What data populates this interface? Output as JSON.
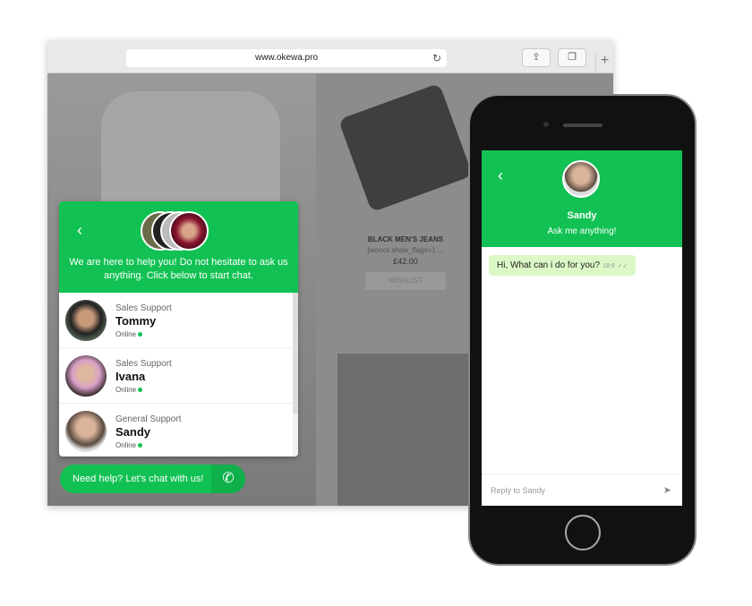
{
  "browser": {
    "url": "www.okewa.pro"
  },
  "product": {
    "title": "BLACK MEN'S JEANS",
    "subtitle": "[woocs show_flags=1 ...",
    "price": "£42.00",
    "wishlist": "WISHLIST"
  },
  "widget": {
    "intro": "We are here to help you! Do not hesitate to ask us anything. Click below to start chat.",
    "agents": [
      {
        "role": "Sales Support",
        "name": "Tommy",
        "status": "Online"
      },
      {
        "role": "Sales Support",
        "name": "Ivana",
        "status": "Online"
      },
      {
        "role": "General Support",
        "name": "Sandy",
        "status": "Online"
      }
    ],
    "cta": "Need help? Let's chat with us!"
  },
  "chat": {
    "name": "Sandy",
    "tagline": "Ask me anything!",
    "message": "Hi, What can i do for you?",
    "time": "18:9",
    "reply_placeholder": "Reply to Sandy"
  },
  "colors": {
    "accent": "#12c153",
    "bubble": "#dcf8c6"
  }
}
